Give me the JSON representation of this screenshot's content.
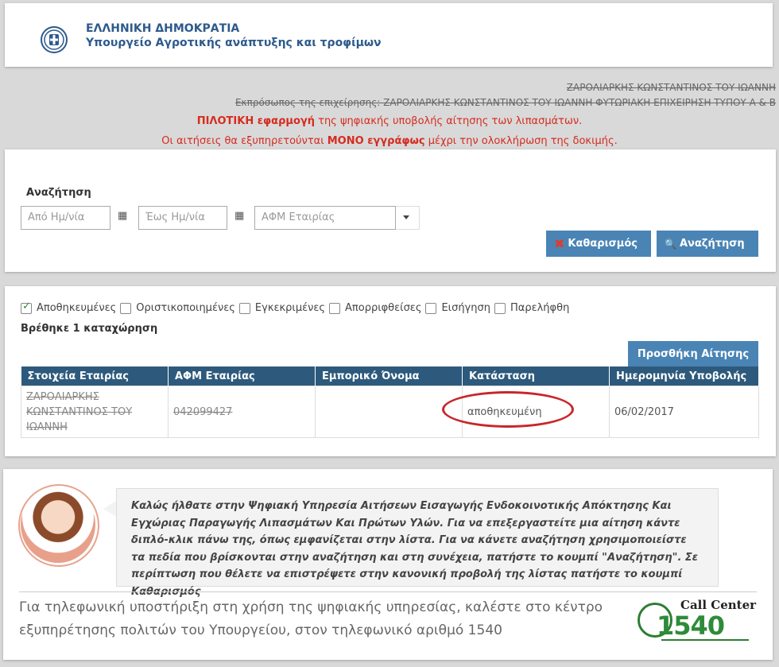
{
  "header": {
    "line1": "ΕΛΛΗΝΙΚΗ ΔΗΜΟΚΡΑΤΙΑ",
    "line2": "Υπουργείο Αγροτικής ανάπτυξης και τροφίμων"
  },
  "info": {
    "struck_line1": "ΖΑΡΟΛΙΑΡΚΗΣ ΚΩΝΣΤΑΝΤΙΝΟΣ ΤΟΥ ΙΩΑΝΝΗ",
    "struck_line2": "Εκπρόσωπος της επιχείρησης: ΖΑΡΟΛΙΑΡΚΗΣ ΚΩΝΣΤΑΝΤΙΝΟΣ ΤΟΥ ΙΩΑΝΝΗ ΦΥΤΩΡΙΑΚΗ ΕΠΙΧΕΙΡΗΣΗ ΤΥΠΟΥ Α & Β",
    "notice1_bold": "ΠΙΛΟΤΙΚΗ εφαρμογή",
    "notice1_rest": " της ψηφιακής υποβολής αίτησης των λιπασμάτων.",
    "notice2_a": "Οι αιτήσεις θα εξυπηρετούνται ",
    "notice2_bold": "ΜΟΝΟ εγγράφως",
    "notice2_b": " μέχρι την ολοκλήρωση της δοκιμής."
  },
  "search": {
    "title": "Αναζήτηση",
    "from_placeholder": "Από Ημ/νία",
    "to_placeholder": "Έως Ημ/νία",
    "afm_placeholder": "ΑΦΜ Εταιρίας",
    "clear_label": "Καθαρισμός",
    "search_label": "Αναζήτηση"
  },
  "filters": [
    {
      "label": "Αποθηκευμένες",
      "checked": true
    },
    {
      "label": "Οριστικοποιημένες",
      "checked": false
    },
    {
      "label": "Εγκεκριμένες",
      "checked": false
    },
    {
      "label": "Απορριφθείσες",
      "checked": false
    },
    {
      "label": "Εισήγηση",
      "checked": false
    },
    {
      "label": "Παρελήφθη",
      "checked": false
    }
  ],
  "list": {
    "found_text": "Βρέθηκε 1 καταχώρηση",
    "add_label": "Προσθήκη Αίτησης",
    "columns": [
      "Στοιχεία Εταιρίας",
      "ΑΦΜ Εταιρίας",
      "Εμπορικό Όνομα",
      "Κατάσταση",
      "Ημερομηνία Υποβολής"
    ],
    "rows": [
      {
        "company": "ΖΑΡΟΛΙΑΡΚΗΣ ΚΩΝΣΤΑΝΤΙΝΟΣ ΤΟΥ ΙΩΑΝΝΗ",
        "afm": "042099427",
        "trade_name": "",
        "status": "αποθηκευμένη",
        "date": "06/02/2017"
      }
    ]
  },
  "help": {
    "welcome": "Καλώς ήλθατε στην Ψηφιακή Υπηρεσία Αιτήσεων Εισαγωγής Ενδοκοινοτικής Απόκτησης Και Εγχώριας Παραγωγής Λιπασμάτων Και Πρώτων Υλών. Για να επεξεργαστείτε μια αίτηση κάντε διπλό-κλικ πάνω της, όπως εμφανίζεται στην λίστα. Για να κάνετε αναζήτηση χρησιμοποιείστε τα πεδία που βρίσκονται στην αναζήτηση και στη συνέχεια, πατήστε το κουμπί \"Αναζήτηση\". Σε περίπτωση που θέλετε να επιστρέψετε στην κανονική προβολή της λίστας πατήστε το κουμπί Καθαρισμός",
    "support": "Για τηλεφωνική υποστήριξη στη χρήση της ψηφιακής υπηρεσίας, καλέστε στο κέντρο εξυπηρέτησης πολιτών του Υπουργείου, στον τηλεφωνικό αριθμό 1540",
    "cc_title": "Call Center",
    "cc_number": "1540"
  },
  "colors": {
    "accent": "#4a84b5",
    "table_header": "#2d5a7c",
    "notice_red": "#d62b1f",
    "highlight_oval": "#c8262a"
  }
}
